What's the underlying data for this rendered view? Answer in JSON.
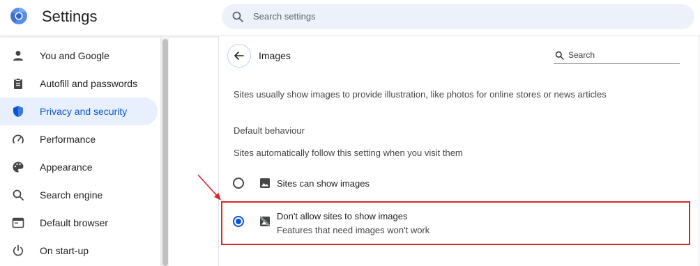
{
  "header": {
    "app_title": "Settings",
    "search_placeholder": "Search settings",
    "logo_icon": "chrome-logo-icon",
    "search_icon": "search-icon"
  },
  "sidebar": {
    "items": [
      {
        "label": "You and Google",
        "icon": "person-icon",
        "active": false
      },
      {
        "label": "Autofill and passwords",
        "icon": "clipboard-icon",
        "active": false
      },
      {
        "label": "Privacy and security",
        "icon": "shield-icon",
        "active": true
      },
      {
        "label": "Performance",
        "icon": "speedometer-icon",
        "active": false
      },
      {
        "label": "Appearance",
        "icon": "palette-icon",
        "active": false
      },
      {
        "label": "Search engine",
        "icon": "search-icon",
        "active": false
      },
      {
        "label": "Default browser",
        "icon": "browser-window-icon",
        "active": false
      },
      {
        "label": "On start-up",
        "icon": "power-icon",
        "active": false
      }
    ]
  },
  "card": {
    "title": "Images",
    "search_placeholder": "Search",
    "description": "Sites usually show images to provide illustration, like photos for online stores or news articles",
    "section_heading": "Default behaviour",
    "section_subtitle": "Sites automatically follow this setting when you visit them",
    "options": [
      {
        "label": "Sites can show images",
        "sublabel": "",
        "checked": false,
        "icon": "image-icon"
      },
      {
        "label": "Don't allow sites to show images",
        "sublabel": "Features that need images won't work",
        "checked": true,
        "icon": "image-off-icon"
      }
    ]
  },
  "colors": {
    "accent": "#0b57d0",
    "active_nav_bg": "#e8f0fe",
    "annotation_red": "#e0222a"
  }
}
